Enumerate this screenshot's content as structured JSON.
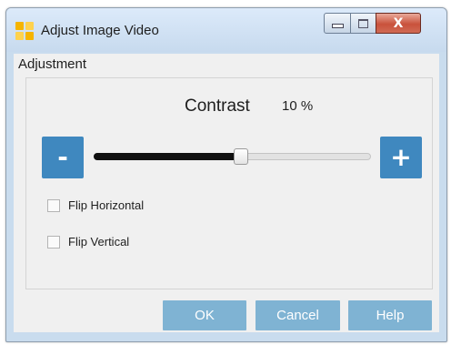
{
  "window": {
    "title": "Adjust Image Video",
    "controls": {
      "minimize_icon": "minimize-icon",
      "maximize_icon": "maximize-icon",
      "close_symbol": "X"
    }
  },
  "adjustment": {
    "section_label": "Adjustment",
    "contrast_label": "Contrast",
    "contrast_value": "10 %",
    "minus_label": "-",
    "plus_label": "+",
    "slider_level": 0.53
  },
  "options": {
    "flip_horizontal": {
      "label": "Flip Horizontal",
      "checked": false
    },
    "flip_vertical": {
      "label": "Flip Vertical",
      "checked": false
    }
  },
  "buttons": {
    "ok": "OK",
    "cancel": "Cancel",
    "help": "Help"
  },
  "colors": {
    "accent": "#3f88bf",
    "action_button": "#7fb3d3",
    "slider_fill": "#101010"
  }
}
